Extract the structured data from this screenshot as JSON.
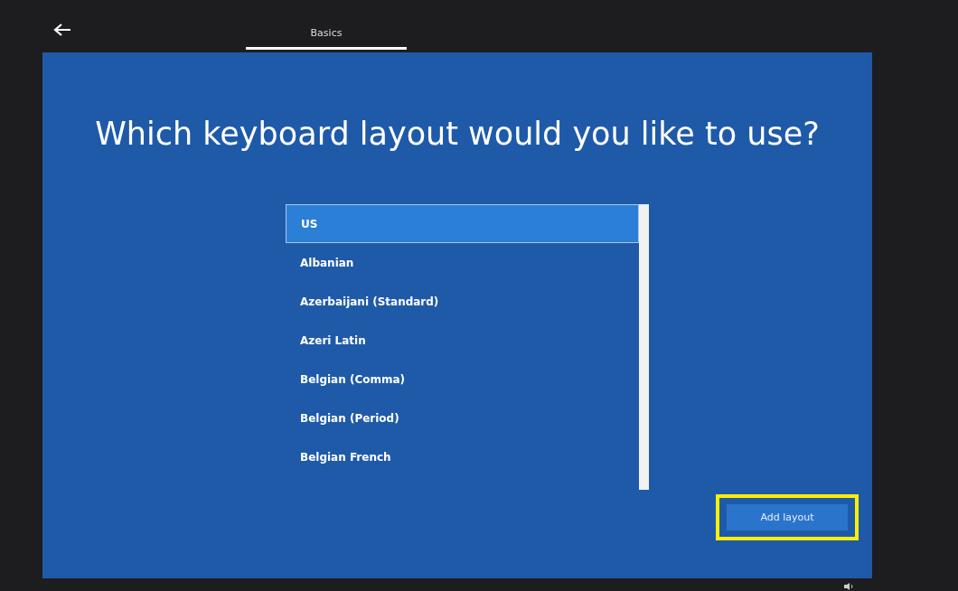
{
  "header": {
    "tab": {
      "label": "Basics",
      "selected": true
    }
  },
  "title": "Which keyboard layout would you like to use?",
  "layouts": [
    {
      "name": "US",
      "selected": true
    },
    {
      "name": "Albanian",
      "selected": false
    },
    {
      "name": "Azerbaijani (Standard)",
      "selected": false
    },
    {
      "name": "Azeri Latin",
      "selected": false
    },
    {
      "name": "Belgian (Comma)",
      "selected": false
    },
    {
      "name": "Belgian (Period)",
      "selected": false
    },
    {
      "name": "Belgian French",
      "selected": false
    }
  ],
  "add_button": {
    "label": "Add layout",
    "highlighted": true
  }
}
